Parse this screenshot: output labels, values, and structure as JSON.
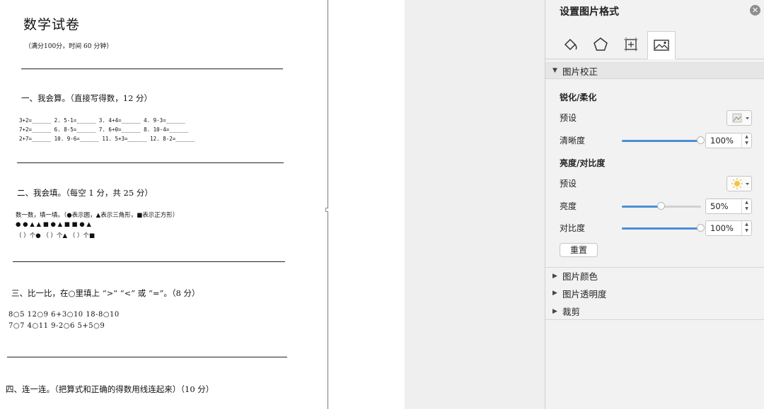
{
  "document": {
    "title": "数学试卷",
    "subtitle": "（满分100分，时间 60 分钟）",
    "sec1_head": "一、我会算。（直接写得数，12 分）",
    "sec1_lines": [
      "3+2=______ 2. 5-1=______ 3. 4+4=______ 4. 9-3=______",
      "7+2=______ 6. 8-5=______ 7. 6+0=______ 8. 10-4=______",
      "2+7=______ 10. 9-6=______ 11. 5+3=______ 12. 8-2=______"
    ],
    "sec2_head": "二、我会填。（每空 1 分，共 25 分）",
    "sec2_instruction": "数一数，填一填。（●表示圆，▲表示三角形，■表示正方形）",
    "sec2_shapes": "●  ●  ▲  ▲  ■  ●  ▲  ■  ■  ●  ▲",
    "sec2_blanks": "（  ）个●    （  ）个▲    （  ）个■",
    "sec3_head": "三、比一比，在○里填上 “>”  “<” 或 “=”。（8 分）",
    "sec3_lines": [
      "8○5  12○9  6+3○10  18-8○10",
      "7○7  4○11  9-2○6  5+5○9"
    ],
    "sec4_head": "四、连一连。（把算式和正确的得数用线连起来）（10 分）"
  },
  "panel": {
    "title": "设置图片格式",
    "tabs": [
      "fill-line-icon",
      "effects-pentagon-icon",
      "size-properties-icon",
      "picture-icon"
    ],
    "active_tab": "picture-icon",
    "sections": {
      "correction": "图片校正",
      "color": "图片颜色",
      "transparency": "图片透明度",
      "crop": "裁剪"
    },
    "sharpen_head": "锐化/柔化",
    "preset_label": "预设",
    "clarity_label": "清晰度",
    "clarity_value": "100%",
    "clarity_level": 1.0,
    "bright_head": "亮度/对比度",
    "preset_label2": "预设",
    "brightness_label": "亮度",
    "brightness_value": "50%",
    "brightness_level": 0.5,
    "contrast_label": "对比度",
    "contrast_value": "100%",
    "contrast_level": 1.0,
    "reset_label": "重置",
    "accent_color": "#4a8fd6"
  }
}
